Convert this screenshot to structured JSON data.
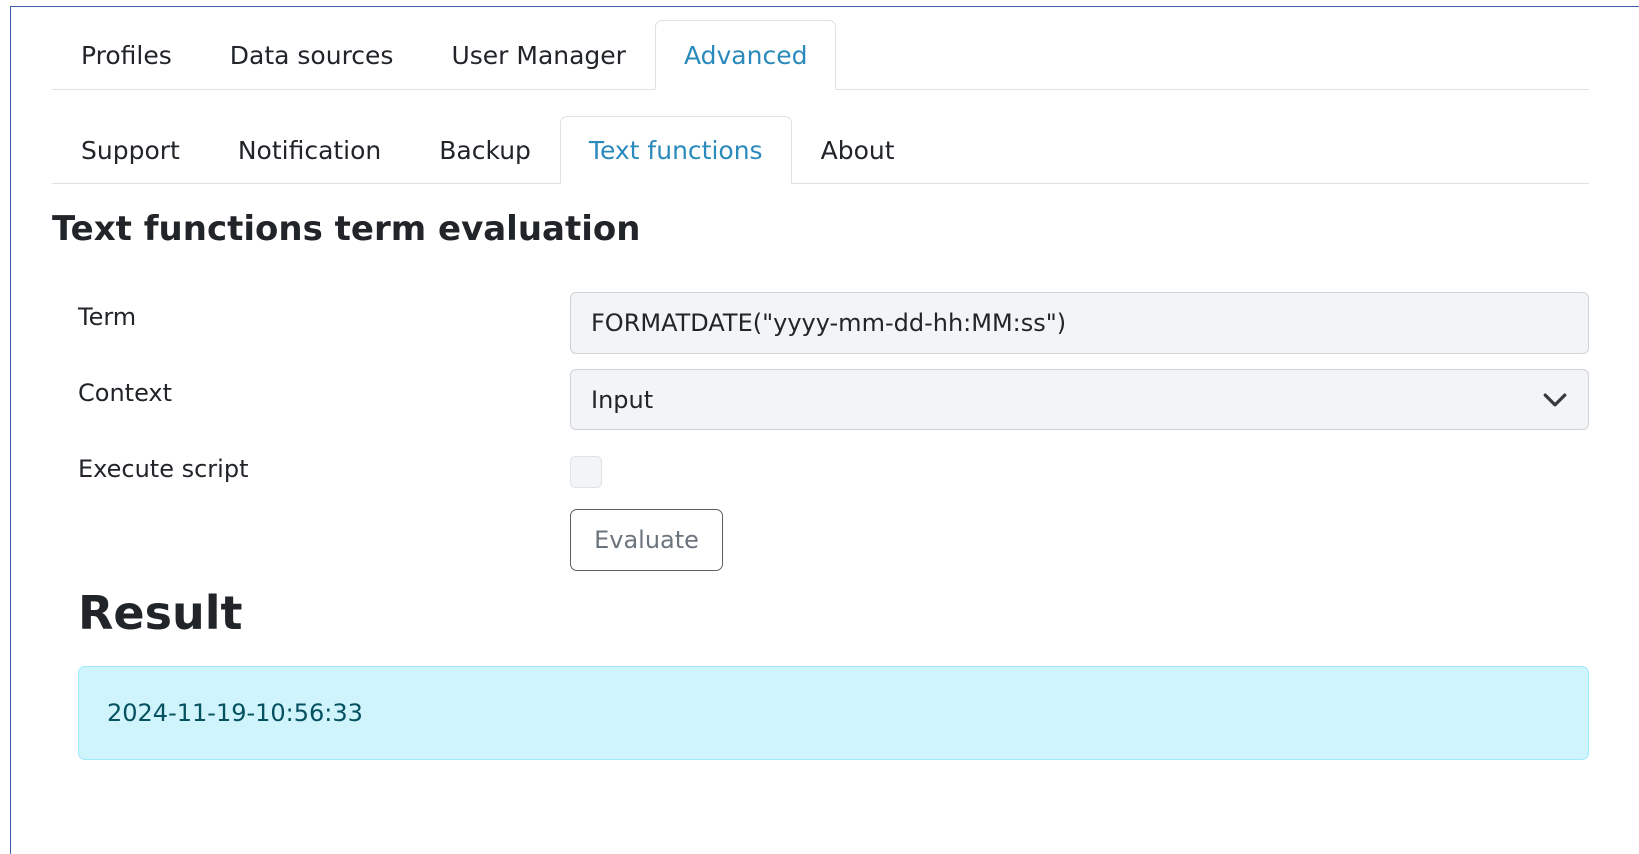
{
  "primary_tabs": [
    {
      "label": "Profiles",
      "active": false
    },
    {
      "label": "Data sources",
      "active": false
    },
    {
      "label": "User Manager",
      "active": false
    },
    {
      "label": "Advanced",
      "active": true
    }
  ],
  "secondary_tabs": [
    {
      "label": "Support",
      "active": false
    },
    {
      "label": "Notification",
      "active": false
    },
    {
      "label": "Backup",
      "active": false
    },
    {
      "label": "Text functions",
      "active": true
    },
    {
      "label": "About",
      "active": false
    }
  ],
  "form": {
    "title": "Text functions term evaluation",
    "term_label": "Term",
    "term_value": "FORMATDATE(\"yyyy-mm-dd-hh:MM:ss\")",
    "context_label": "Context",
    "context_value": "Input",
    "execute_label": "Execute script",
    "execute_checked": false,
    "evaluate_label": "Evaluate"
  },
  "result": {
    "title": "Result",
    "value": "2024-11-19-10:56:33"
  },
  "colors": {
    "active_tab": "#2a8abc",
    "result_bg": "#cff4fc",
    "result_text": "#055160",
    "frame_border": "#3c5fa8"
  }
}
